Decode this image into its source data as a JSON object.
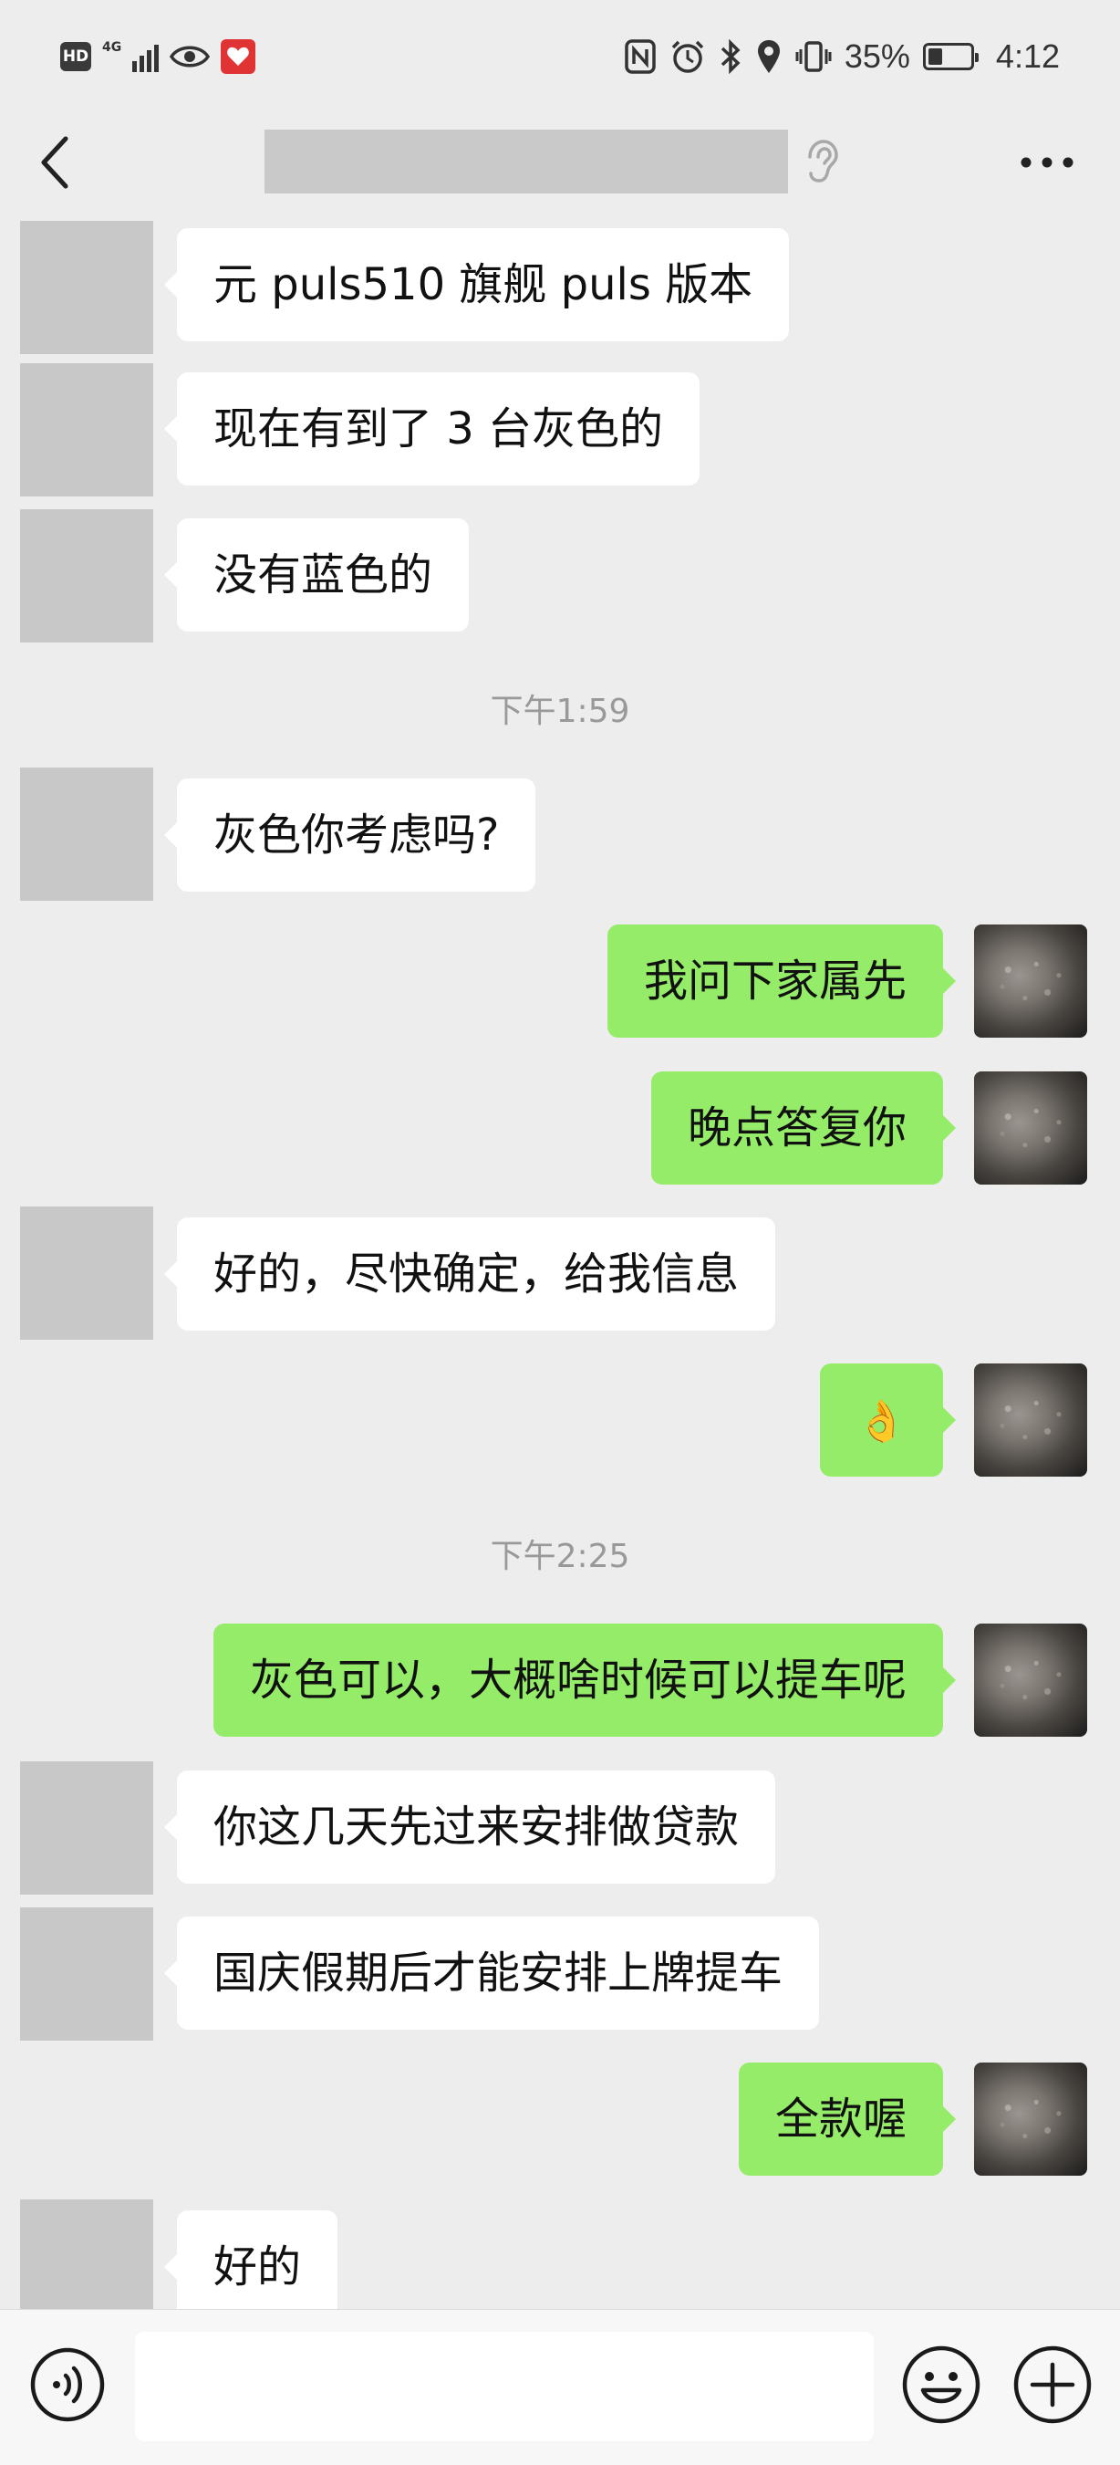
{
  "status_bar": {
    "hd": "HD",
    "network": "4G",
    "battery_percent": "35%",
    "battery_level": 0.35,
    "time": "4:12"
  },
  "nav": {
    "contact_name": "",
    "back_icon": "chevron-left-icon",
    "ear_icon": "ear-icon",
    "more_icon": "more-horizontal-icon"
  },
  "chat": {
    "timestamps": [
      "下午1:59",
      "下午2:25"
    ],
    "messages": [
      {
        "side": "left",
        "text": "元 puls510 旗舰 puls 版本"
      },
      {
        "side": "left",
        "text": "现在有到了 3 台灰色的"
      },
      {
        "side": "left",
        "text": "没有蓝色的"
      },
      {
        "side": "left",
        "text": "灰色你考虑吗?"
      },
      {
        "side": "right",
        "text": "我问下家属先"
      },
      {
        "side": "right",
        "text": "晚点答复你"
      },
      {
        "side": "left",
        "text": "好的，尽快确定，给我信息"
      },
      {
        "side": "right",
        "text": "👌"
      },
      {
        "side": "right",
        "text": "灰色可以，大概啥时候可以提车呢"
      },
      {
        "side": "left",
        "text": "你这几天先过来安排做贷款"
      },
      {
        "side": "left",
        "text": "国庆假期后才能安排上牌提车"
      },
      {
        "side": "right",
        "text": "全款喔"
      },
      {
        "side": "left",
        "text": "好的"
      }
    ]
  },
  "input_bar": {
    "voice_icon": "voice-icon",
    "message_value": "",
    "emoji_icon": "emoji-icon",
    "plus_icon": "plus-icon"
  },
  "colors": {
    "background": "#ededed",
    "sent_bubble": "#95ec69",
    "received_bubble": "#ffffff",
    "timestamp_text": "#999999"
  }
}
